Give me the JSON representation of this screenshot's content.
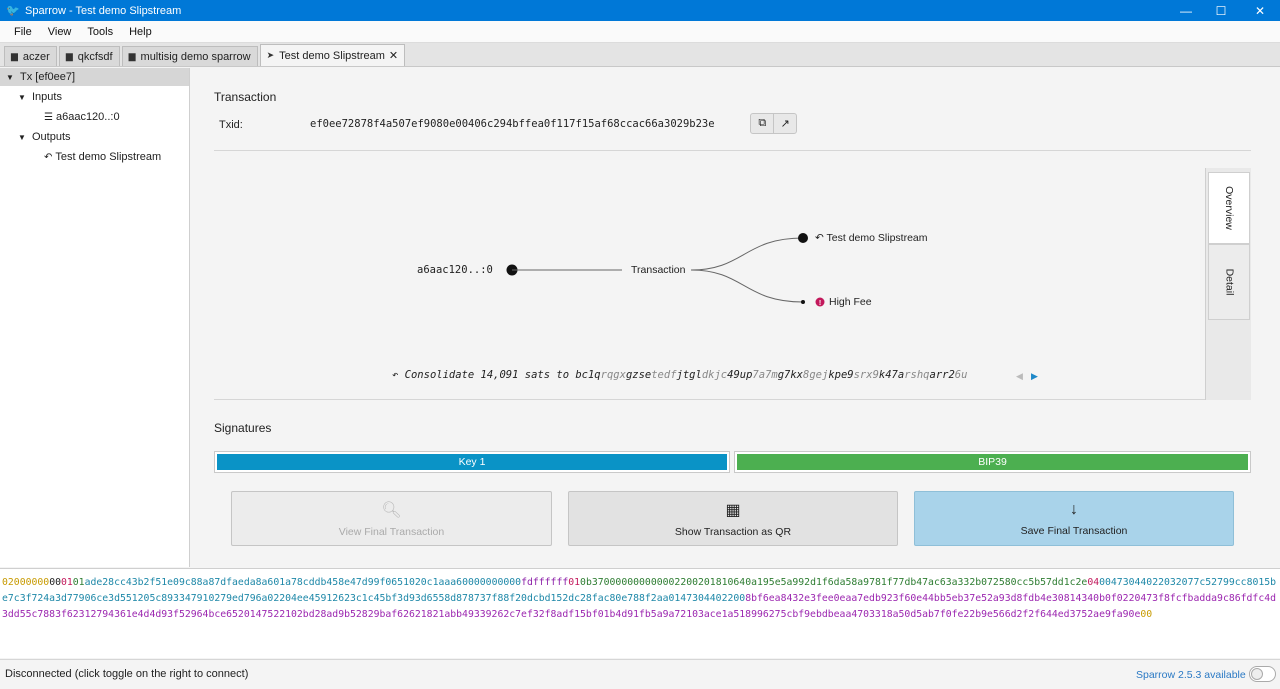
{
  "window": {
    "title": "Sparrow - Test demo Slipstream",
    "minimize": "—",
    "maximize": "☐",
    "close": "✕"
  },
  "menu": [
    "File",
    "View",
    "Tools",
    "Help"
  ],
  "tabs": [
    {
      "label": "aczer",
      "icon": "wallet-icon"
    },
    {
      "label": "qkcfsdf",
      "icon": "wallet-icon"
    },
    {
      "label": "multisig demo sparrow",
      "icon": "wallet-icon"
    },
    {
      "label": "Test demo Slipstream",
      "icon": "send-icon",
      "close": "✕"
    }
  ],
  "tree": {
    "root": "Tx [ef0ee7]",
    "inputs_label": "Inputs",
    "input_item": "a6aac120..:0",
    "outputs_label": "Outputs",
    "output_item": "Test demo Slipstream"
  },
  "transaction": {
    "section_title": "Transaction",
    "txid_label": "Txid:",
    "txid": "ef0ee72878f4a507ef9080e00406c294bffea0f117f15af68ccac66a3029b23e"
  },
  "diagram": {
    "input": "a6aac120..:0",
    "center": "Transaction",
    "output": "Test demo Slipstream",
    "fee": "High Fee",
    "consolidate_prefix": "Consolidate 14,091 sats to ",
    "address_parts": [
      [
        "bc1q",
        "a"
      ],
      [
        "rqgx",
        "b"
      ],
      [
        "gzse",
        "a"
      ],
      [
        "tedf",
        "b"
      ],
      [
        "jtgl",
        "a"
      ],
      [
        "dkjc",
        "b"
      ],
      [
        "49up",
        "a"
      ],
      [
        "7a7m",
        "b"
      ],
      [
        "g7kx",
        "a"
      ],
      [
        "8gej",
        "b"
      ],
      [
        "kpe9",
        "a"
      ],
      [
        "srx9",
        "b"
      ],
      [
        "k47a",
        "a"
      ],
      [
        "rshq",
        "b"
      ],
      [
        "arr2",
        "a"
      ],
      [
        "6u",
        "b"
      ]
    ],
    "tab_overview": "Overview",
    "tab_detail": "Detail"
  },
  "signatures": {
    "section_title": "Signatures",
    "key1": "Key 1",
    "key2": "BIP39",
    "key1_color": "#0a93c6",
    "key2_color": "#4caf50"
  },
  "actions": {
    "view_final": "View Final Transaction",
    "show_qr": "Show Transaction as QR",
    "save_final": "Save Final Transaction"
  },
  "hex": [
    [
      "02000000",
      "#c79a00"
    ],
    [
      "00",
      "#222"
    ],
    [
      "01",
      "#c2185b"
    ],
    [
      "01",
      "#2e7d32"
    ],
    [
      "ade28cc43b2f51e09c88a87dfaeda8a601a78cddb458e47d99f0651020c1aaa6",
      "#1e88a8"
    ],
    [
      "0000000000",
      "#1e88a8"
    ],
    [
      "fdffffff",
      "#8e24aa"
    ],
    [
      "01",
      "#c2185b"
    ],
    [
      "0b37000000000000",
      "#2e7d32"
    ],
    [
      "22002018",
      "#2e7d32"
    ],
    [
      "10640a195e5a992d1f6da58a9781f77db47ac63a332b072580cc5b57dd1c2e",
      "#2e7d32"
    ],
    [
      "04",
      "#c2185b"
    ],
    [
      "0047",
      "#1e88a8"
    ],
    [
      "3044022032077c52799cc8015be7c3f724a3d77906ce3d551205c893347910279ed796a02204ee45912623c1c45bf3d93d6558d878737f88f20dcbd152dc28fac80e788f2aa0147304402200",
      "#1e88a8"
    ],
    [
      "8bf6ea8432e3fee0eaa7edb923f60e44bb5eb37e52a93d8fdb4e30814340b0f0220473f8fcfbadda9c86fdfc4d3dd55c7883f62312794361e4d4d93f52964bce6520147522102bd28ad9b52829baf62621821abb49339262c7ef32f8adf15bf01b4d91fb5a9a72103ace1a518996275cbf9ebdbeaa4703318a50d5ab7f0fe22b9e566d2f2f644ed3752ae9fa90e",
      "#9c27b0"
    ],
    [
      "00",
      "#c79a00"
    ]
  ],
  "status": {
    "text": "Disconnected (click toggle on the right to connect)",
    "update": "Sparrow 2.5.3 available"
  }
}
